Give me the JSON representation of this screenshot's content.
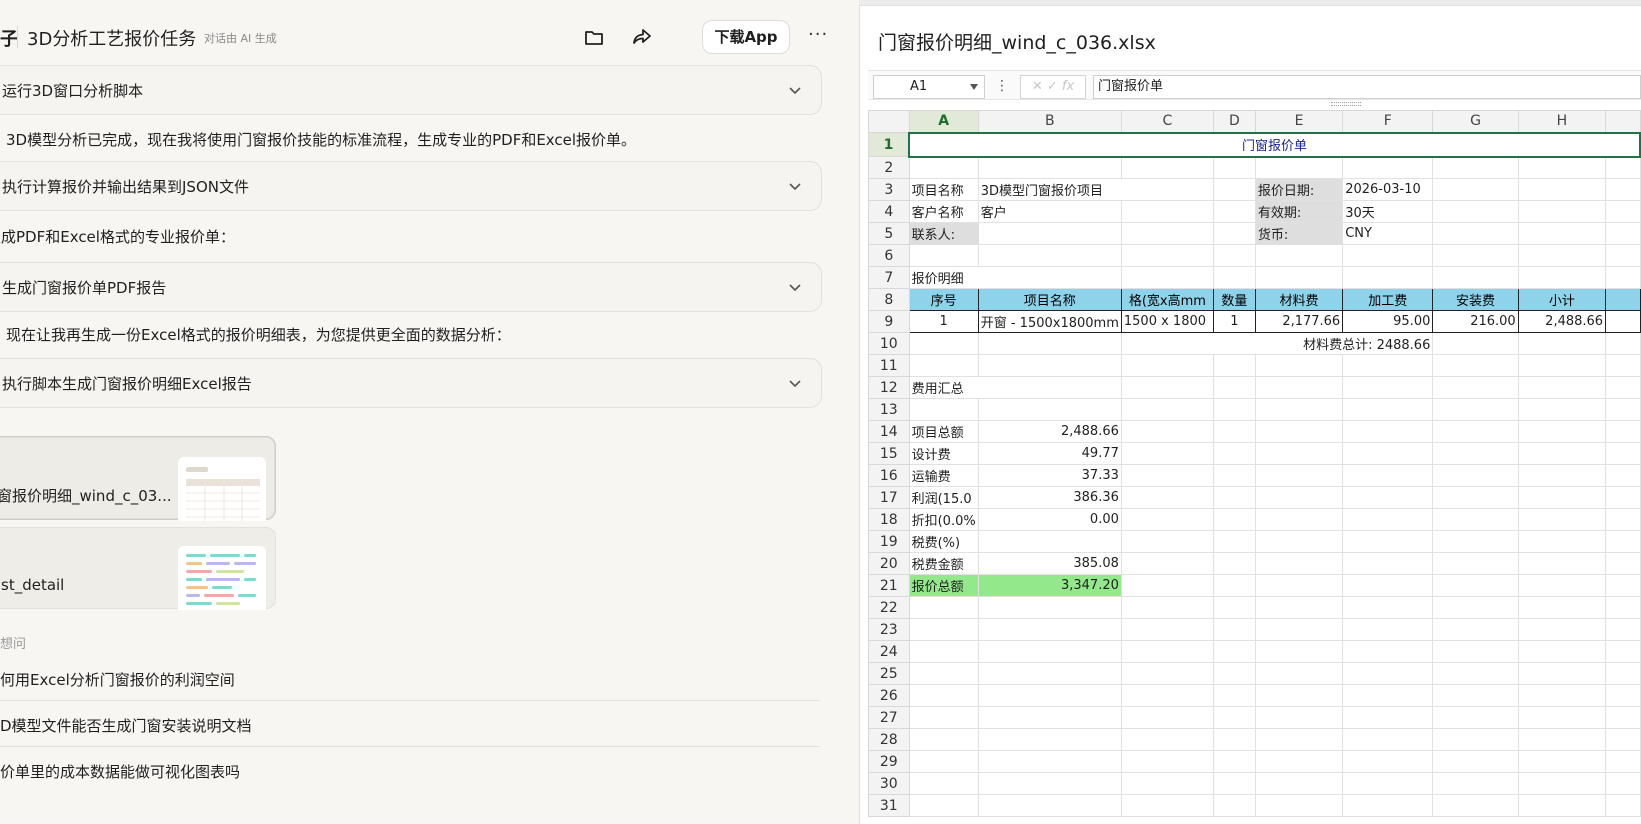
{
  "chat": {
    "header": {
      "fragment": "子",
      "title": "3D分析工艺报价任务",
      "ai_note": "对话由 AI 生成",
      "download_label": "下载App",
      "more_label": "···"
    },
    "steps": [
      "运行3D窗口分析脚本",
      "执行计算报价并输出结果到JSON文件",
      "生成门窗报价单PDF报告",
      "执行脚本生成门窗报价明细Excel报告"
    ],
    "messages": [
      "3D模型分析已完成，现在我将使用门窗报价技能的标准流程，生成专业的PDF和Excel报价单。",
      "生成PDF和Excel格式的专业报价单：",
      "现在让我再生成一份Excel格式的报价明细表，为您提供更全面的数据分析："
    ],
    "files": [
      {
        "name": "窗报价明细_wind_c_03..."
      },
      {
        "name": "st_detail"
      }
    ],
    "suggestions_label": "想问",
    "suggestions": [
      "何用Excel分析门窗报价的利润空间",
      "D模型文件能否生成门窗安装说明文档",
      "价单里的成本数据能做可视化图表吗"
    ]
  },
  "spreadsheet": {
    "file_title": "门窗报价明细_wind_c_036.xlsx",
    "name_box": "A1",
    "formula_dots": "⋮",
    "formula_btns": "✕ ✓ fx",
    "formula_value": "门窗报价单",
    "columns": [
      "A",
      "B",
      "C",
      "D",
      "E",
      "F",
      "G",
      "H"
    ],
    "rows": [
      "1",
      "2",
      "3",
      "4",
      "5",
      "6",
      "7",
      "8",
      "9",
      "10",
      "11",
      "12",
      "13",
      "14",
      "15",
      "16",
      "17",
      "18",
      "19",
      "20",
      "21",
      "22",
      "23",
      "24",
      "25",
      "26",
      "27",
      "28",
      "29",
      "30",
      "31"
    ],
    "cells": {
      "title": "门窗报价单",
      "r3a": "项目名称",
      "r3b": "3D模型门窗报价项目",
      "r3e": "报价日期:",
      "r3f": "2026-03-10",
      "r4a": "客户名称",
      "r4b": "客户",
      "r4e": "有效期:",
      "r4f": "30天",
      "r5a": "联系人:",
      "r5e": "货币:",
      "r5f": "CNY",
      "r7a": "报价明细",
      "h_seq": "序号",
      "h_name": "项目名称",
      "h_size": "格(宽x高mm",
      "h_qty": "数量",
      "h_mat": "材料费",
      "h_proc": "加工费",
      "h_inst": "安装费",
      "h_sub": "小计",
      "r9_seq": "1",
      "r9_name": "开窗 - 1500x1800mm",
      "r9_size": "1500 x 1800",
      "r9_qty": "1",
      "r9_mat": "2,177.66",
      "r9_proc": "95.00",
      "r9_inst": "216.00",
      "r9_sub": "2,488.66",
      "r10_total": "材料费总计: 2488.66",
      "r12a": "费用汇总",
      "r14a": "项目总额",
      "r14b": "2,488.66",
      "r15a": "设计费",
      "r15b": "49.77",
      "r16a": "运输费",
      "r16b": "37.33",
      "r17a": "利润(15.0",
      "r17b": "386.36",
      "r18a": "折扣(0.0%",
      "r18b": "0.00",
      "r19a": "税费(%)",
      "r20a": "税费金额",
      "r20b": "385.08",
      "r21a": "报价总额",
      "r21b": "3,347.20"
    }
  },
  "colors": {
    "accent_green": "#217346",
    "header_blue": "#8fd3ea",
    "total_green": "#93e88c",
    "title_navy": "#1a2590"
  }
}
